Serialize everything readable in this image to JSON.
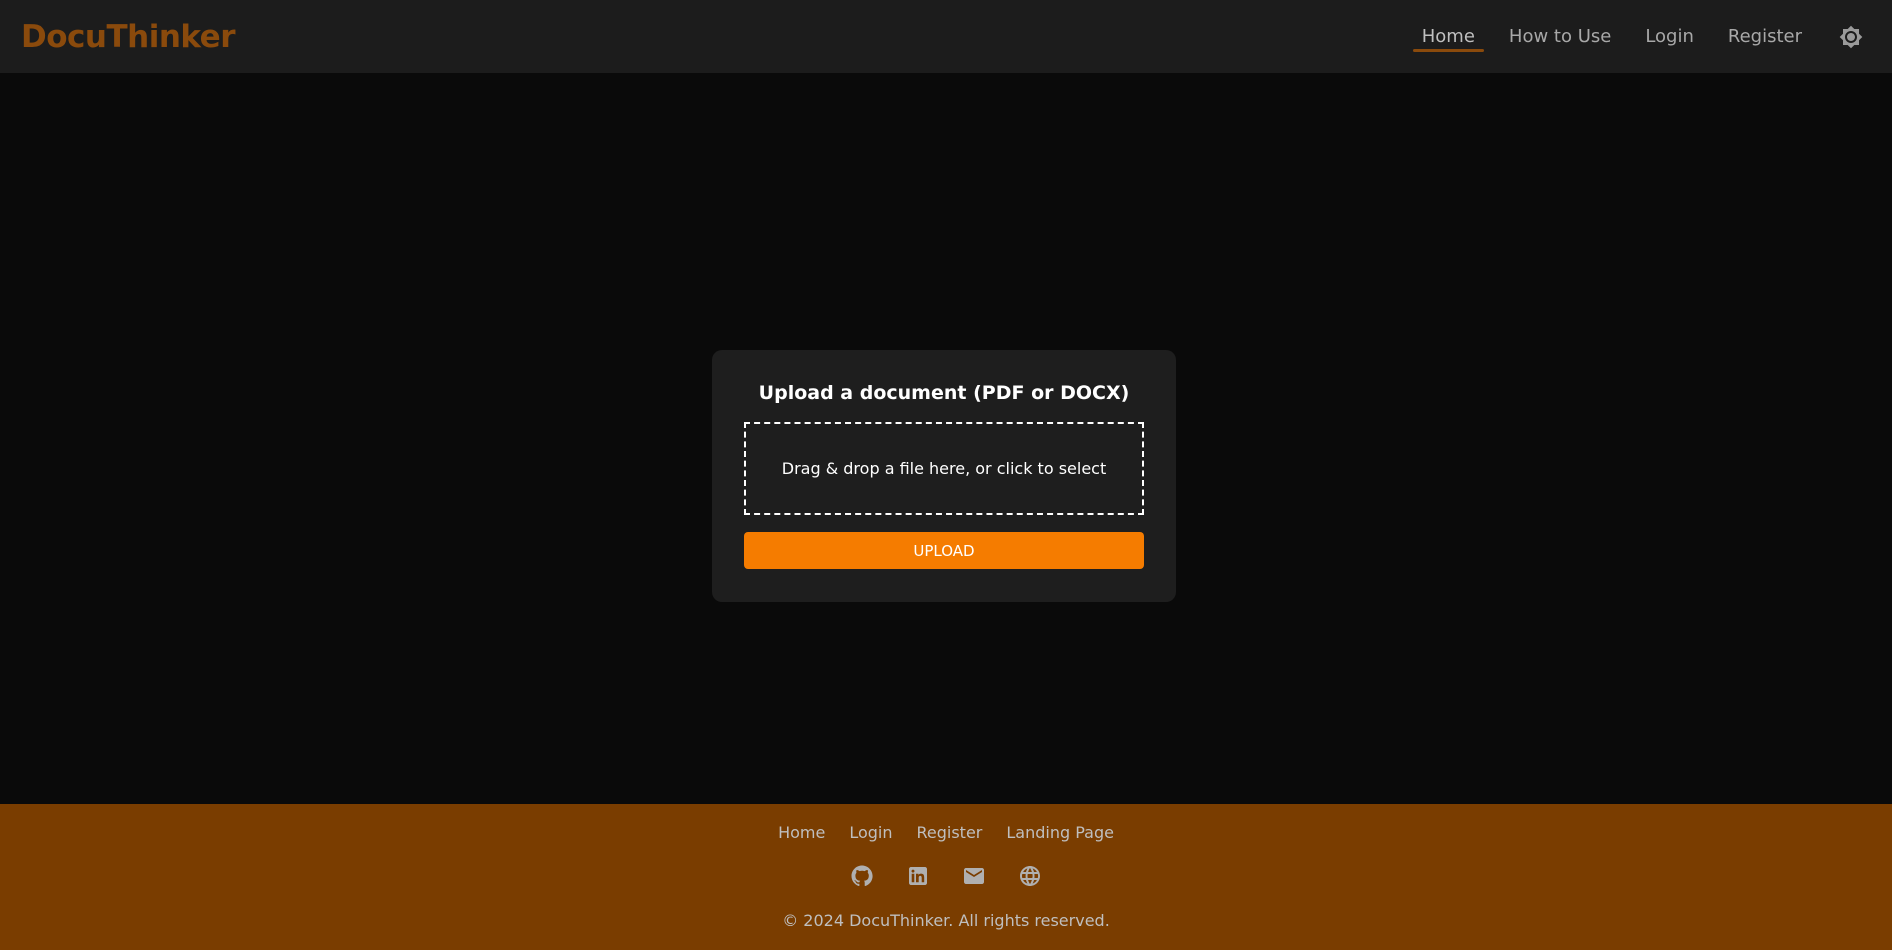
{
  "header": {
    "logo": "DocuThinker",
    "nav": [
      "Home",
      "How to Use",
      "Login",
      "Register"
    ],
    "active": "Home",
    "theme_icon": "brightness-icon"
  },
  "upload_card": {
    "title": "Upload a document (PDF or DOCX)",
    "dropzone_text": "Drag & drop a file here, or click to select",
    "button_label": "UPLOAD"
  },
  "footer": {
    "links": [
      "Home",
      "Login",
      "Register",
      "Landing Page"
    ],
    "icons": [
      "github-icon",
      "linkedin-icon",
      "email-icon",
      "globe-icon"
    ],
    "copyright": "© 2024 DocuThinker. All rights reserved."
  },
  "colors": {
    "accent": "#f57c00",
    "logo": "#8a4a0c",
    "footer_bg": "#7a3d00",
    "page_bg": "#0a0a0a",
    "navbar_bg": "#1c1c1c",
    "card_bg": "#1e1e1e"
  }
}
